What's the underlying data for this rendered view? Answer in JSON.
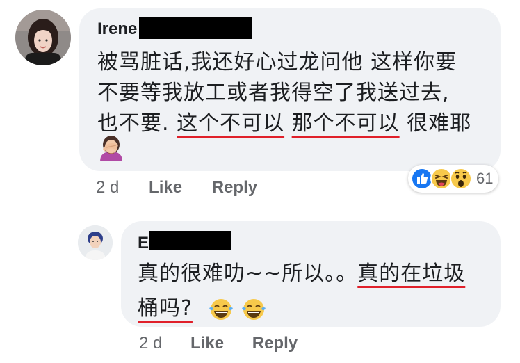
{
  "comment": {
    "author": "Irene",
    "lines": [
      "被骂脏话,我还好心过龙问他 这样你要",
      "不要等我放工或者我得空了我送过去,"
    ],
    "line3": {
      "prefix": "也不要. ",
      "underlined_a": "这个不可以",
      "underlined_b": "那个不可以",
      "suffix": " 很难耶"
    },
    "emoji": "facepalm",
    "meta": {
      "time": "2 d",
      "like": "Like",
      "reply": "Reply"
    },
    "reactions": {
      "icons": [
        "like",
        "haha",
        "wow"
      ],
      "count": "61"
    }
  },
  "reply": {
    "author": "E",
    "line1": {
      "prefix": "真的很难叻~~所以。。",
      "underlined": "真的在垃圾"
    },
    "line2": {
      "underlined": "桶吗?"
    },
    "emojis": [
      "tears-of-joy",
      "tears-of-joy"
    ],
    "meta": {
      "time": "2 d",
      "like": "Like",
      "reply": "Reply"
    }
  },
  "colors": {
    "bubble": "#f0f2f5",
    "text": "#1c1e21",
    "meta": "#65676b",
    "underline": "#e0202a",
    "like_blue": "#1877f2",
    "emoji_yellow": "#f7c94b"
  }
}
